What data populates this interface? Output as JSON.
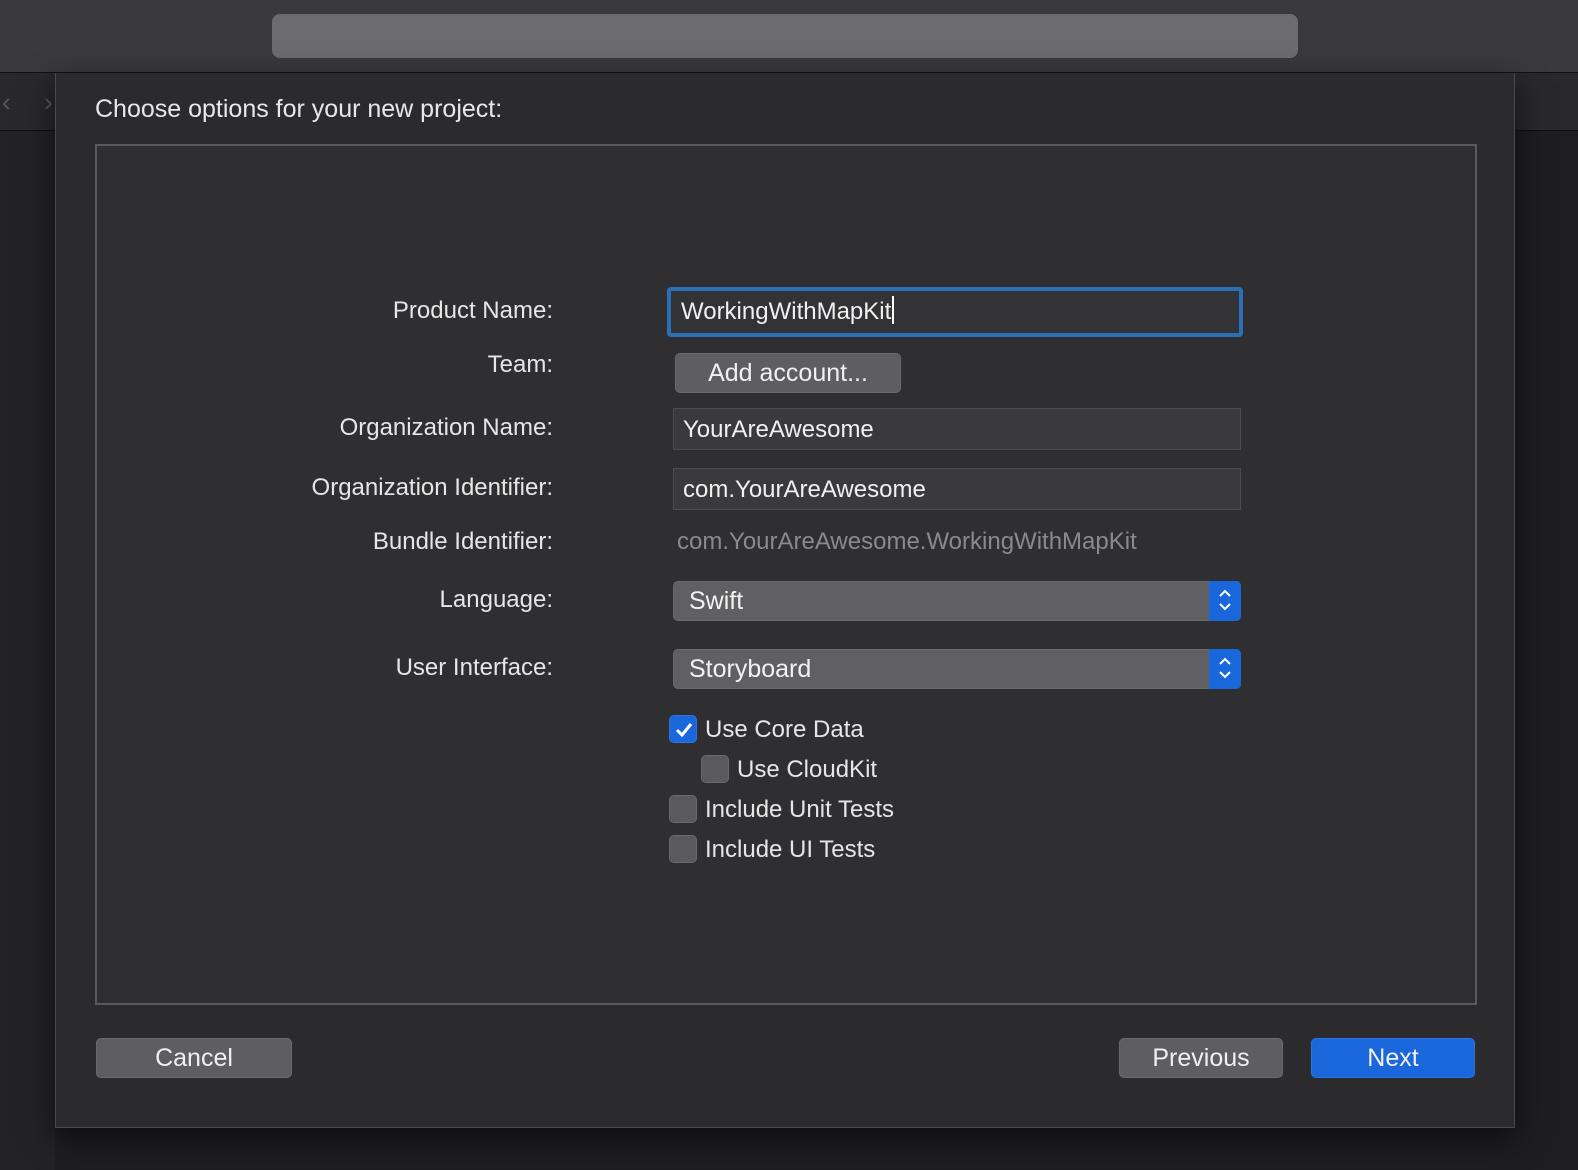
{
  "dialog": {
    "title": "Choose options for your new project:"
  },
  "form": {
    "product_name_label": "Product Name:",
    "product_name_value": "WorkingWithMapKit",
    "team_label": "Team:",
    "team_button": "Add account...",
    "org_name_label": "Organization Name:",
    "org_name_value": "YourAreAwesome",
    "org_id_label": "Organization Identifier:",
    "org_id_value": "com.YourAreAwesome",
    "bundle_id_label": "Bundle Identifier:",
    "bundle_id_value": "com.YourAreAwesome.WorkingWithMapKit",
    "language_label": "Language:",
    "language_value": "Swift",
    "ui_label": "User Interface:",
    "ui_value": "Storyboard",
    "checkboxes": [
      {
        "label": "Use Core Data",
        "checked": true
      },
      {
        "label": "Use CloudKit",
        "checked": false
      },
      {
        "label": "Include Unit Tests",
        "checked": false
      },
      {
        "label": "Include UI Tests",
        "checked": false
      }
    ]
  },
  "footer": {
    "cancel": "Cancel",
    "previous": "Previous",
    "next": "Next"
  },
  "icons": {
    "back": "chevron-left-icon",
    "forward": "chevron-right-icon",
    "popup_stepper": "up-down-chevron-icon",
    "checkmark": "checkmark-icon"
  },
  "colors": {
    "accent": "#1a66db",
    "focus_ring": "#2a6fb8",
    "window_bg": "#2b2b2d"
  }
}
